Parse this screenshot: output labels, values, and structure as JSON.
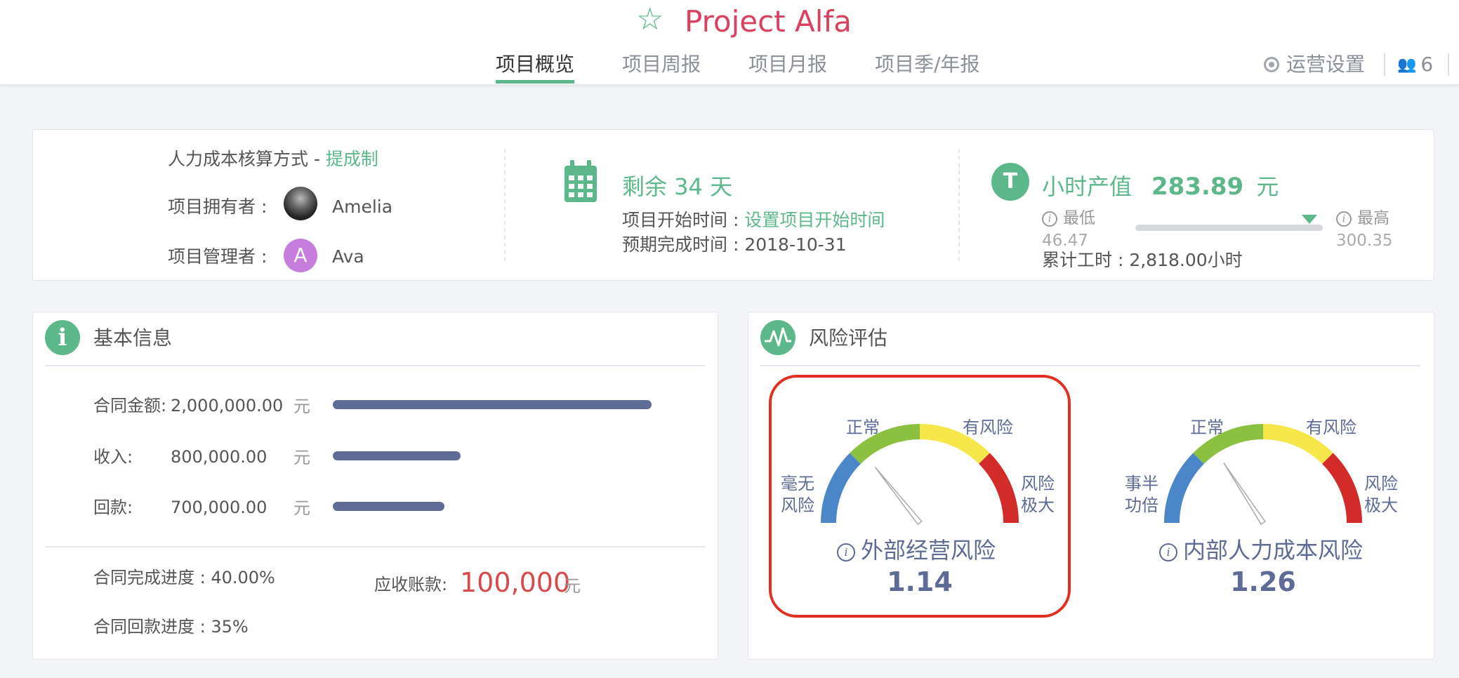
{
  "header": {
    "title": "Project Alfa",
    "tabs": [
      "项目概览",
      "项目周报",
      "项目月报",
      "项目季/年报"
    ],
    "active_tab": 0,
    "ops_settings": "运营设置",
    "member_count": "6"
  },
  "summary": {
    "cost_method_label": "人力成本核算方式 - ",
    "cost_method_value": "提成制",
    "owner_label": "项目拥有者 :",
    "owner_name": "Amelia",
    "manager_label": "项目管理者 :",
    "manager_initial": "A",
    "manager_name": "Ava",
    "remaining": "剩余 34 天",
    "start_label": "项目开始时间 : ",
    "start_value": "设置项目开始时间",
    "end_label": "预期完成时间 : 2018-10-31",
    "hourly_label": "小时产值",
    "hourly_value": "283.89",
    "hourly_unit": "元",
    "min_label": "最低",
    "min_value": "46.47",
    "max_label": "最高",
    "max_value": "300.35",
    "hourly_level": 0.93,
    "total_hours": "累计工时 : 2,818.00小时"
  },
  "basic": {
    "title": "基本信息",
    "rows": [
      {
        "label": "合同金额: ",
        "value": "2,000,000.00",
        "unit": "元",
        "amount": 2000000
      },
      {
        "label": "收入: ",
        "value": "800,000.00",
        "unit": "元",
        "amount": 800000
      },
      {
        "label": "回款: ",
        "value": "700,000.00",
        "unit": "元",
        "amount": 700000
      }
    ],
    "contract_progress": "合同完成进度 : 40.00%",
    "payment_progress": "合同回款进度 : 35%",
    "receivable_label": "应收账款:",
    "receivable_value": "100,000",
    "receivable_unit": "元"
  },
  "risk": {
    "title": "风险评估",
    "gauges": [
      {
        "name": "外部经营风险",
        "value": "1.14",
        "level": 1.14,
        "labels": [
          "毫无",
          "风险",
          "正常",
          "有风险",
          "风险",
          "极大"
        ]
      },
      {
        "name": "内部人力成本风险",
        "value": "1.26",
        "level": 1.26,
        "labels": [
          "事半",
          "功倍",
          "正常",
          "有风险",
          "风险",
          "极大"
        ]
      }
    ],
    "colors": {
      "blue": "#4a86c8",
      "green": "#8cc040",
      "yellow": "#f5e64a",
      "red": "#d32a2a"
    }
  }
}
